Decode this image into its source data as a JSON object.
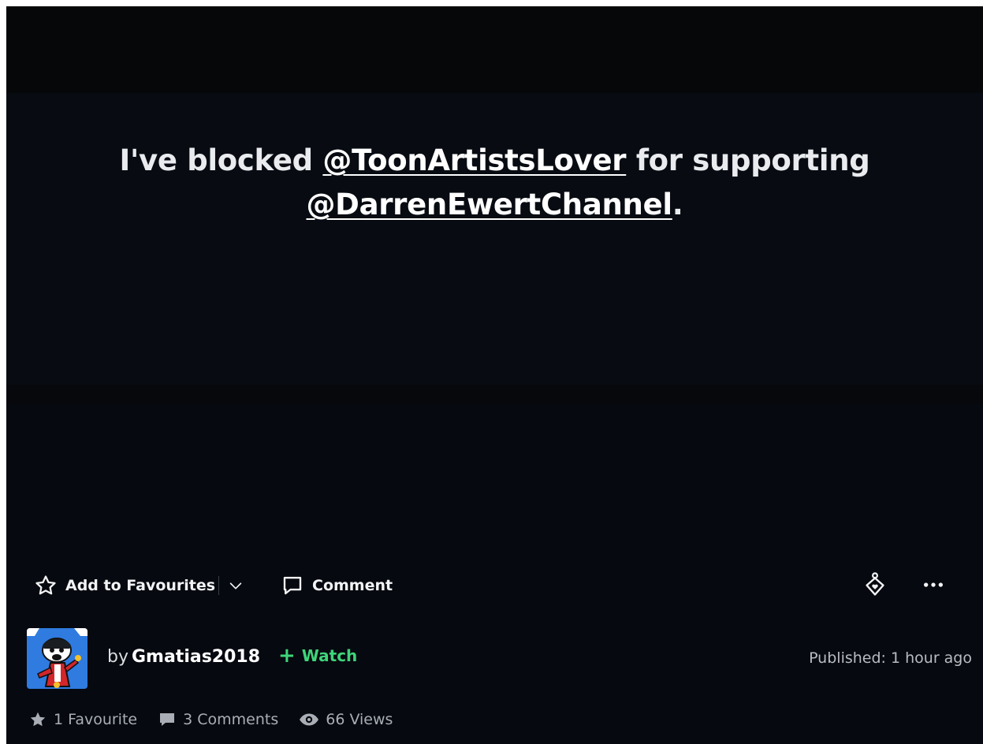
{
  "post": {
    "text_before": "I've blocked ",
    "mention_1": "@ToonArtistsLover",
    "text_middle": " for supporting",
    "mention_2": "@DarrenEwertChannel",
    "text_after": "."
  },
  "actions": {
    "favourite_label": "Add to Favourites",
    "comment_label": "Comment"
  },
  "author": {
    "by_label": "by",
    "username": "Gmatias2018",
    "watch_label": "Watch",
    "published": "Published: 1 hour ago"
  },
  "stats": {
    "favourites": "1 Favourite",
    "comments": "3 Comments",
    "views": "66 Views"
  },
  "icons": {
    "favourite": "star-outline-icon",
    "dropdown": "chevron-down-icon",
    "comment": "speech-bubble-icon",
    "share": "share-heart-icon",
    "more": "more-dots-icon",
    "watch": "plus-icon",
    "stat_favourite": "star-icon",
    "stat_comment": "comment-icon",
    "stat_views": "eye-icon"
  },
  "colors": {
    "background": "#06090f",
    "watch_accent": "#3fd47a",
    "avatar_bg": "#2f7be0"
  }
}
